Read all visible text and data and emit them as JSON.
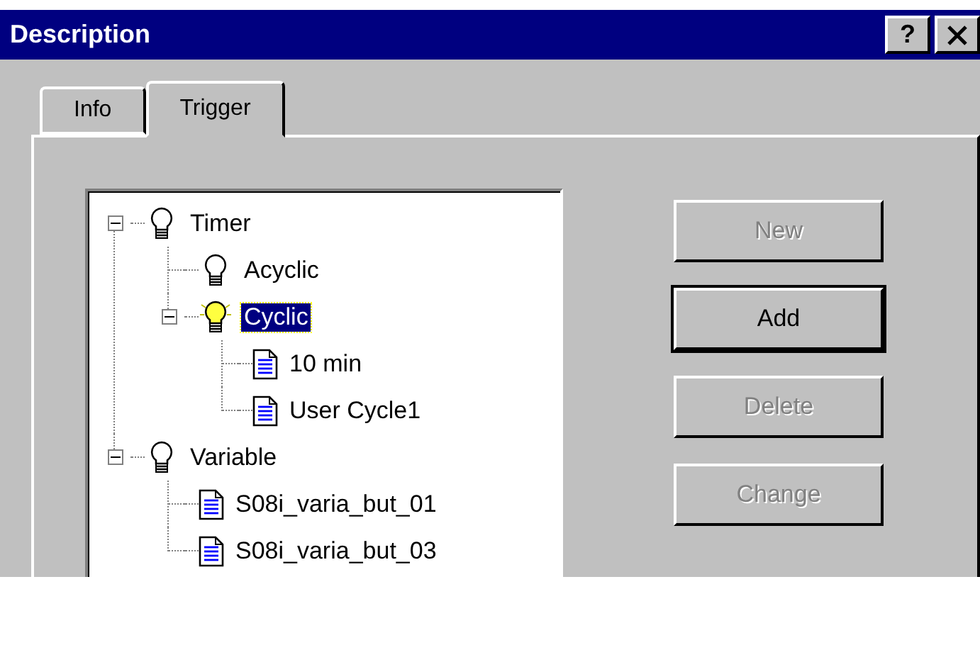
{
  "window": {
    "title": "Description",
    "help_label": "?"
  },
  "tabs": [
    {
      "label": "Info",
      "selected": false
    },
    {
      "label": "Trigger",
      "selected": true
    }
  ],
  "tree": [
    {
      "label": "Timer",
      "kind": "bulb",
      "lit": false,
      "expanded": true,
      "selected": false,
      "children": [
        {
          "label": "Acyclic",
          "kind": "bulb",
          "lit": false,
          "selected": false
        },
        {
          "label": "Cyclic",
          "kind": "bulb",
          "lit": true,
          "expanded": true,
          "selected": true,
          "children": [
            {
              "label": "10 min",
              "kind": "document",
              "selected": false
            },
            {
              "label": "User Cycle1",
              "kind": "document",
              "selected": false
            }
          ]
        }
      ]
    },
    {
      "label": "Variable",
      "kind": "bulb",
      "lit": false,
      "expanded": true,
      "selected": false,
      "children": [
        {
          "label": "S08i_varia_but_01",
          "kind": "document",
          "selected": false
        },
        {
          "label": "S08i_varia_but_03",
          "kind": "document",
          "selected": false
        }
      ]
    }
  ],
  "buttons": [
    {
      "label": "New",
      "disabled": true,
      "default": false
    },
    {
      "label": "Add",
      "disabled": false,
      "default": true
    },
    {
      "label": "Delete",
      "disabled": true,
      "default": false
    },
    {
      "label": "Change",
      "disabled": true,
      "default": false
    }
  ]
}
